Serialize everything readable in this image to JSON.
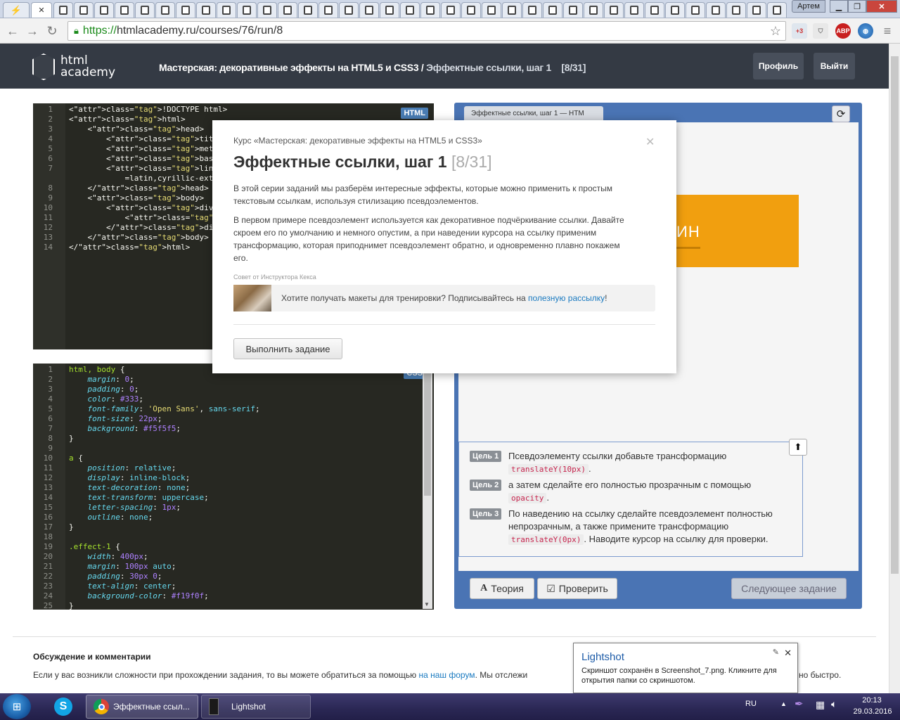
{
  "browser": {
    "url_scheme": "https://",
    "url_rest": "htmlacademy.ru/courses/76/run/8",
    "user": "Артем",
    "ext_badge": "+3",
    "abp": "ABP"
  },
  "site": {
    "logo_line1": "html",
    "logo_line2": "academy",
    "crumb_course": "Мастерская: декоративные эффекты на HTML5 и CSS3 /",
    "crumb_step": " Эффектные ссылки, шаг 1",
    "crumb_count": "[8/31]",
    "profile": "Профиль",
    "logout": "Выйти"
  },
  "html_editor": {
    "badge": "HTML",
    "lines": [
      {
        "n": "1",
        "c": "<!DOCTYPE html>"
      },
      {
        "n": "2",
        "c": "<html>"
      },
      {
        "n": "3",
        "c": "    <head>"
      },
      {
        "n": "4",
        "c": "        <title>Эффектные ссылки,"
      },
      {
        "n": "5",
        "c": "        <meta charset=\"utf-8\">"
      },
      {
        "n": "6",
        "c": "        <base href=\"/assets/cour"
      },
      {
        "n": "7",
        "c": "        <link href='//fonts.goog"
      },
      {
        "n": "",
        "c": "            =latin,cyrillic-ext'"
      },
      {
        "n": "8",
        "c": "    </head>"
      },
      {
        "n": "9",
        "c": "    <body>"
      },
      {
        "n": "10",
        "c": "        <div class=\"effect-1\">"
      },
      {
        "n": "11",
        "c": "            <a href=\"#\">Апельси"
      },
      {
        "n": "12",
        "c": "        </div>"
      },
      {
        "n": "13",
        "c": "    </body>"
      },
      {
        "n": "14",
        "c": "</html>"
      }
    ]
  },
  "css_editor": {
    "badge": "CSS",
    "lines": [
      {
        "n": "1",
        "c": "html, body {"
      },
      {
        "n": "2",
        "c": "    margin: 0;"
      },
      {
        "n": "3",
        "c": "    padding: 0;"
      },
      {
        "n": "4",
        "c": "    color: #333;"
      },
      {
        "n": "5",
        "c": "    font-family: 'Open Sans', sans-serif;"
      },
      {
        "n": "6",
        "c": "    font-size: 22px;"
      },
      {
        "n": "7",
        "c": "    background: #f5f5f5;"
      },
      {
        "n": "8",
        "c": "}"
      },
      {
        "n": "9",
        "c": ""
      },
      {
        "n": "10",
        "c": "a {"
      },
      {
        "n": "11",
        "c": "    position: relative;"
      },
      {
        "n": "12",
        "c": "    display: inline-block;"
      },
      {
        "n": "13",
        "c": "    text-decoration: none;"
      },
      {
        "n": "14",
        "c": "    text-transform: uppercase;"
      },
      {
        "n": "15",
        "c": "    letter-spacing: 1px;"
      },
      {
        "n": "16",
        "c": "    outline: none;"
      },
      {
        "n": "17",
        "c": "}"
      },
      {
        "n": "18",
        "c": ""
      },
      {
        "n": "19",
        "c": ".effect-1 {"
      },
      {
        "n": "20",
        "c": "    width: 400px;"
      },
      {
        "n": "21",
        "c": "    margin: 100px auto;"
      },
      {
        "n": "22",
        "c": "    padding: 30px 0;"
      },
      {
        "n": "23",
        "c": "    text-align: center;"
      },
      {
        "n": "24",
        "c": "    background-color: #f19f0f;"
      },
      {
        "n": "25",
        "c": "}"
      }
    ]
  },
  "preview": {
    "tab_title": "Эффектные ссылки, шаг 1 — HTM",
    "link_text": "ИН",
    "goals": [
      {
        "label": "Цель 1",
        "before": "Псевдоэлементу ссылки добавьте трансформацию ",
        "code": "translateY(10px)",
        "after": "."
      },
      {
        "label": "Цель 2",
        "before": "а затем сделайте его полностью прозрачным с помощью ",
        "code": "opacity",
        "after": "."
      },
      {
        "label": "Цель 3",
        "before": "По наведению на ссылку сделайте псевдоэлемент полностью непрозрачным, а также примените трансформацию ",
        "code": "translateY(0px)",
        "after": ". Наводите курсор на ссылку для проверки."
      }
    ],
    "theory": "Теория",
    "check": "Проверить",
    "next": "Следующее задание"
  },
  "modal": {
    "course": "Курс «Мастерская: декоративные эффекты на HTML5 и CSS3»",
    "title": "Эффектные ссылки, шаг 1",
    "count": "[8/31]",
    "p1": "В этой серии заданий мы разберём интересные эффекты, которые можно применить к простым текстовым ссылкам, используя стилизацию псевдоэлементов.",
    "p2": "В первом примере псевдоэлемент используется как декоративное подчёркивание ссылки. Давайте скроем его по умолчанию и немного опустим, а при наведении курсора на ссылку применим трансформацию, которая приподнимет псевдоэлемент обратно, и одновременно плавно покажем его.",
    "tip_label": "Совет от Инструктора Кекса",
    "tip_text": "Хотите получать макеты для тренировки? Подписывайтесь на ",
    "tip_link": "полезную рассылку",
    "tip_end": "!",
    "button": "Выполнить задание"
  },
  "page": {
    "discuss_title": "Обсуждение и комментарии",
    "discuss_text": "Если у вас возникли сложности при прохождении задания, то вы можете обратиться за помощью ",
    "discuss_link": "на наш форум",
    "discuss_text2": ". Мы отслежи",
    "discuss_tail": "но быстро."
  },
  "lightshot": {
    "title": "Lightshot",
    "body": "Скриншот сохранён в Screenshot_7.png. Кликните для открытия папки со скриншотом."
  },
  "taskbar": {
    "chrome_title": "Эффектные ссыл...",
    "lightshot_title": "Lightshot",
    "lang": "RU",
    "time": "20:13",
    "date": "29.03.2016"
  }
}
